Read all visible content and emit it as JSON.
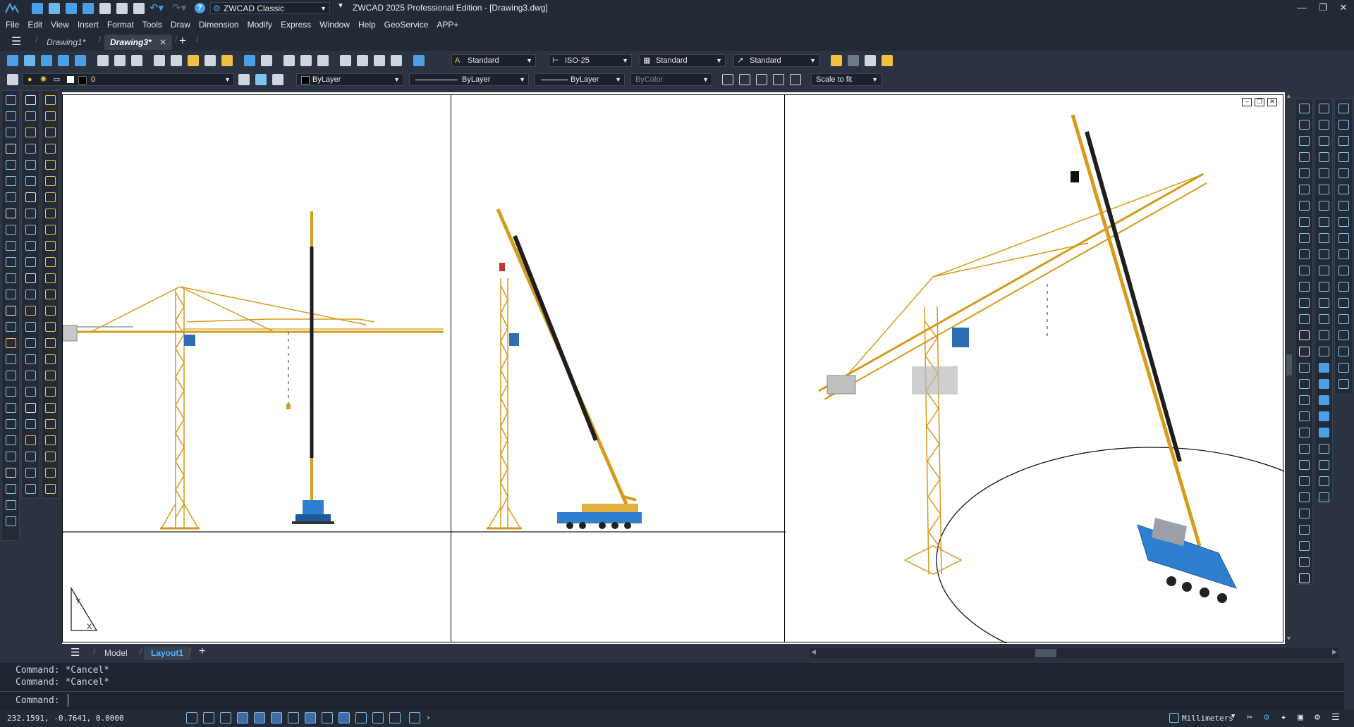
{
  "titlebar": {
    "workspace": "ZWCAD Classic",
    "title": "ZWCAD 2025 Professional Edition - [Drawing3.dwg]"
  },
  "menu": [
    "File",
    "Edit",
    "View",
    "Insert",
    "Format",
    "Tools",
    "Draw",
    "Dimension",
    "Modify",
    "Express",
    "Window",
    "Help",
    "GeoService",
    "APP+"
  ],
  "doc_tabs": [
    {
      "label": "Drawing1*"
    },
    {
      "label": "Drawing3*"
    }
  ],
  "toolbar": {
    "text_style": "Standard",
    "dim_style": "ISO-25",
    "table_style": "Standard",
    "mleader_style": "Standard"
  },
  "properties": {
    "layer": "0",
    "color": "ByLayer",
    "linetype": "ByLayer",
    "lineweight": "ByLayer",
    "plotstyle": "ByColor",
    "scale": "Scale to fit"
  },
  "layout_tabs": {
    "model": "Model",
    "layout1": "Layout1"
  },
  "command": {
    "history": [
      "Command: *Cancel*",
      "Command: *Cancel*"
    ],
    "prompt": "Command:"
  },
  "status": {
    "coords": "232.1591, -0.7641, 0.0000",
    "units": "Millimeters"
  }
}
